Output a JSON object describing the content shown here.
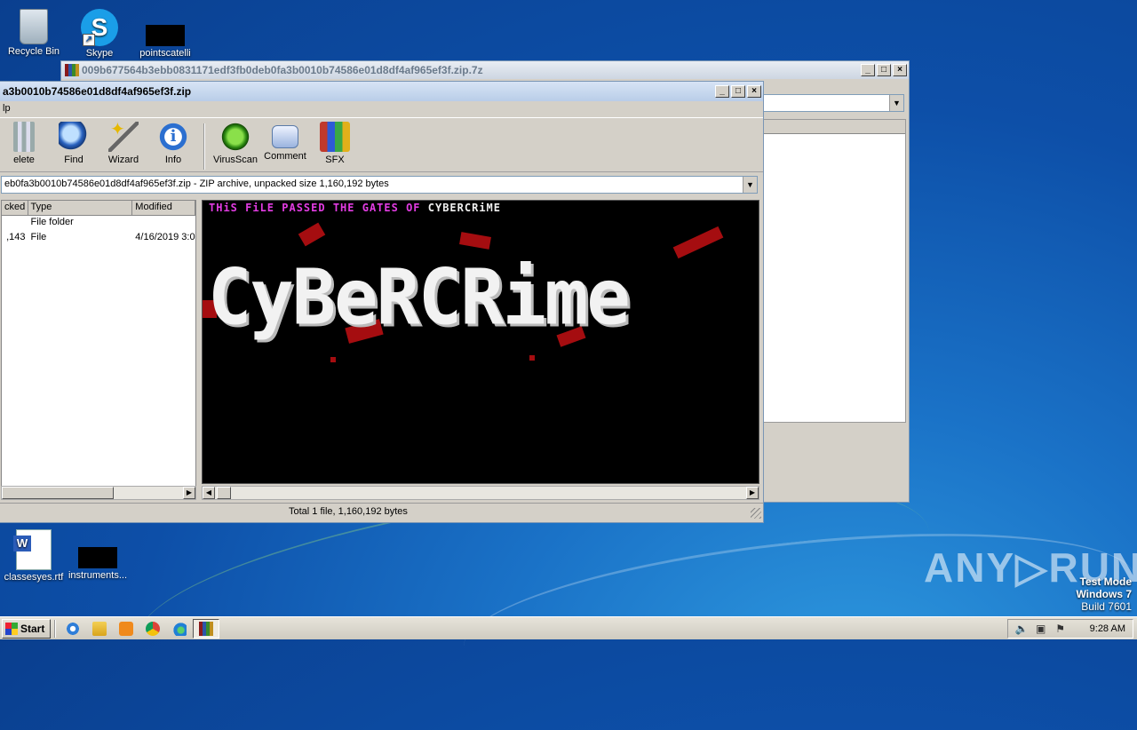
{
  "desktop": {
    "icons": [
      {
        "label": "Recycle Bin"
      },
      {
        "label": "Skype"
      },
      {
        "label": "pointscatelli"
      },
      {
        "label": "classesyes.rtf"
      },
      {
        "label": "instruments..."
      }
    ]
  },
  "back_window": {
    "title": "009b677564b3ebb0831171edf3fb0deb0fa3b0010b74586e01d8df4af965ef3f.zip.7z"
  },
  "front_window": {
    "title": "a3b0010b74586e01d8df4af965ef3f.zip",
    "menu": "lp",
    "toolbar": [
      {
        "label": "elete",
        "icon": "delete-icon"
      },
      {
        "label": "Find",
        "icon": "find-icon"
      },
      {
        "label": "Wizard",
        "icon": "wizard-icon"
      },
      {
        "label": "Info",
        "icon": "info-icon"
      },
      {
        "label": "VirusScan",
        "icon": "virusscan-icon"
      },
      {
        "label": "Comment",
        "icon": "comment-icon"
      },
      {
        "label": "SFX",
        "icon": "sfx-icon"
      }
    ],
    "address": "eb0fa3b0010b74586e01d8df4af965ef3f.zip - ZIP archive, unpacked size 1,160,192 bytes",
    "columns": [
      "cked",
      "Type",
      "Modified"
    ],
    "rows": [
      {
        "packed": "",
        "type": "File folder",
        "modified": ""
      },
      {
        "packed": ",143",
        "type": "File",
        "modified": "4/16/2019 3:0"
      }
    ],
    "viewer": {
      "banner_part1": "THiS FiLE PASSED THE GATES OF",
      "banner_part2": "CYBERCRiME",
      "logo_text": "CyBeRCRime"
    },
    "status": "Total 1 file, 1,160,192 bytes"
  },
  "watermark": {
    "brand": "ANY▷RUN",
    "line1": "Test Mode",
    "line2": "Windows 7",
    "line3": "Build 7601"
  },
  "taskbar": {
    "start_label": "Start",
    "clock": "9:28 AM"
  },
  "colors": {
    "banner_pink": "#e23ce2",
    "blood_red": "#a50d10"
  }
}
